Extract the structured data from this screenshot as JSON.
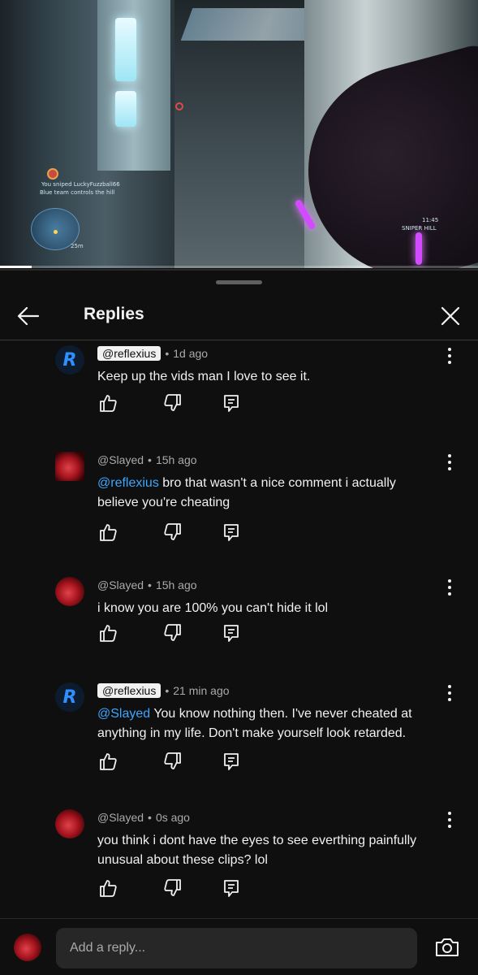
{
  "video": {
    "hud_kill_text": "You sniped LuckyFuzzball66",
    "hud_status_text": "Blue team controls the hill",
    "hud_distance": "25m",
    "hud_timer": "11:45",
    "hud_mode": "SNIPER HILL",
    "progress": 0.066
  },
  "panel": {
    "title": "Replies",
    "back_icon": "arrow-left-icon",
    "close_icon": "close-icon"
  },
  "comments": [
    {
      "author": "@reflexius",
      "author_style": "chip",
      "avatar": "R",
      "time": "1d ago",
      "mention": "",
      "text": "Keep up the vids man I love to see it."
    },
    {
      "author": "@Slayed",
      "author_style": "plain",
      "avatar": "slayed",
      "time": "15h ago",
      "mention": "@reflexius",
      "text": " bro that wasn't a nice comment i actually believe you're cheating"
    },
    {
      "author": "@Slayed",
      "author_style": "plain",
      "avatar": "slayed",
      "time": "15h ago",
      "mention": "",
      "text": "i know you are 100% you can't hide it lol"
    },
    {
      "author": "@reflexius",
      "author_style": "chip",
      "avatar": "R",
      "time": "21 min ago",
      "mention": "@Slayed",
      "text": " You know nothing then. I've never cheated at anything in my life. Don't make yourself look retarded."
    },
    {
      "author": "@Slayed",
      "author_style": "plain",
      "avatar": "slayed",
      "time": "0s ago",
      "mention": "",
      "text": "you think i dont have the eyes to see everthing painfully unusual about these clips? lol"
    }
  ],
  "reply": {
    "placeholder": "Add a reply...",
    "camera_icon": "camera-icon"
  },
  "colors": {
    "background": "#0f0f0f",
    "mention": "#3ea6ff",
    "secondary_text": "#aaaaaa",
    "input_bg": "#272727"
  }
}
